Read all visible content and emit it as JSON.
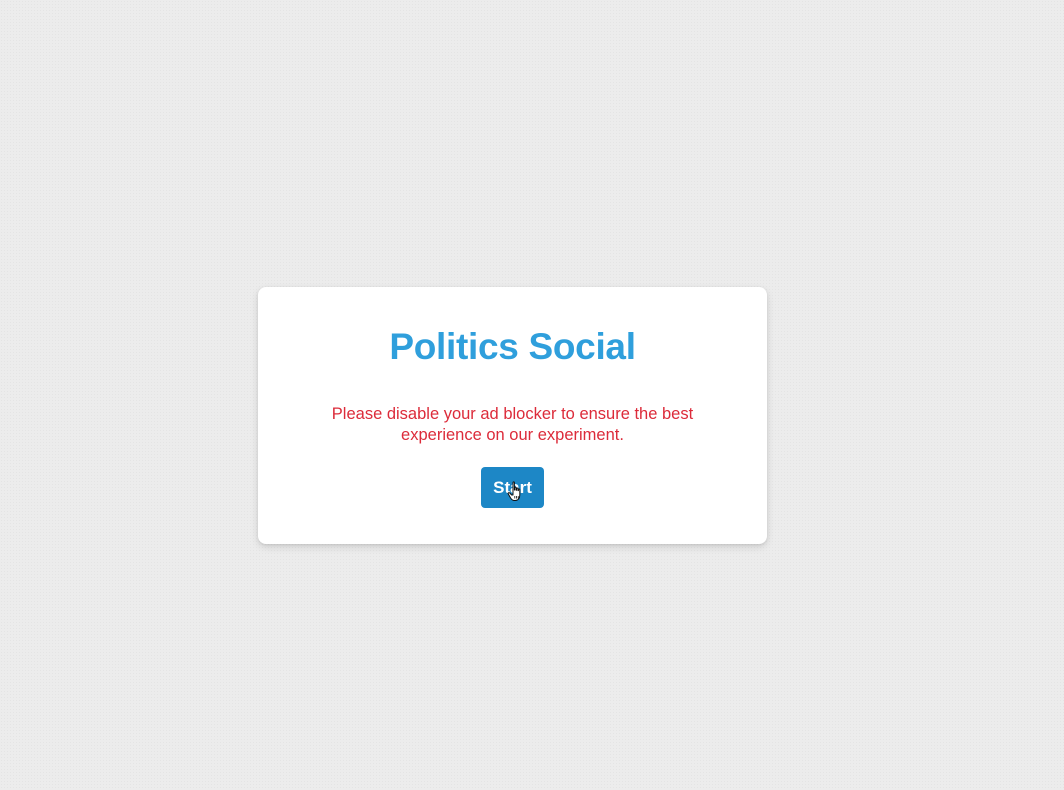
{
  "dialog": {
    "title": "Politics Social",
    "notice": "Please disable your ad blocker to ensure the best experience on our experiment.",
    "start_label": "Start"
  },
  "colors": {
    "title": "#2f9fdc",
    "notice": "#dc2b3a",
    "button": "#1d87c6",
    "background": "#ececec"
  },
  "icons": {
    "cursor": "hand-pointer-icon"
  }
}
